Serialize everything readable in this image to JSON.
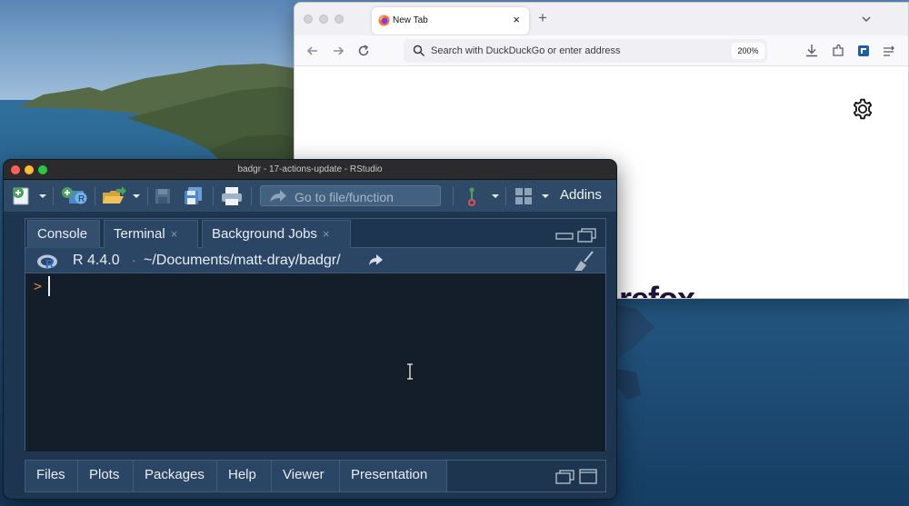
{
  "firefox": {
    "tab_title": "New Tab",
    "url_placeholder": "Search with DuckDuckGo or enter address",
    "zoom": "200%",
    "wordmark": "refox"
  },
  "rstudio": {
    "window_title": "badgr - 17-actions-update - RStudio",
    "goto_placeholder": "Go to file/function",
    "addins_label": "Addins",
    "tabs": [
      {
        "label": "Console"
      },
      {
        "label": "Terminal"
      },
      {
        "label": "Background Jobs"
      }
    ],
    "r_version": "R 4.4.0",
    "separator": "·",
    "path": "~/Documents/matt-dray/badgr/",
    "prompt": ">",
    "bottom_tabs": [
      {
        "label": "Files"
      },
      {
        "label": "Plots"
      },
      {
        "label": "Packages"
      },
      {
        "label": "Help"
      },
      {
        "label": "Viewer"
      },
      {
        "label": "Presentation"
      }
    ]
  },
  "colors": {
    "rstudio_toolbar": "#2f4a66",
    "rstudio_console_bg": "#131e2a",
    "prompt_accent": "#e07f31",
    "firefox_chrome": "#f0f0f4"
  }
}
